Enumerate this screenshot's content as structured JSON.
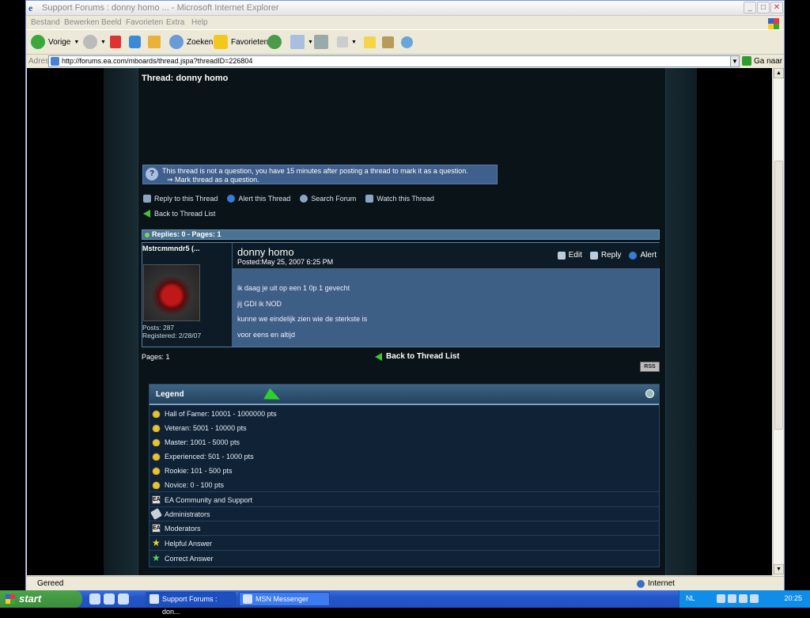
{
  "window": {
    "title": "Support Forums : donny homo ... - Microsoft Internet Explorer"
  },
  "menu": [
    "Bestand",
    "Bewerken",
    "Beeld",
    "Favorieten",
    "Extra",
    "Help"
  ],
  "toolbar": {
    "back": "Vorige",
    "search": "Zoeken",
    "favorites": "Favorieten"
  },
  "address": {
    "label": "Adres",
    "url": "http://forums.ea.com/mboards/thread.jspa?threadID=226804",
    "go": "Ga naar"
  },
  "page": {
    "thread_title": "Thread: donny homo",
    "info_line1": "This thread is not a question, you have 15 minutes after posting a thread to mark it as a question.",
    "info_line2": "Mark thread as a question.",
    "actions": {
      "reply": "Reply to this Thread",
      "alert": "Alert this Thread",
      "search": "Search Forum",
      "watch": "Watch this Thread"
    },
    "back_link": "Back to Thread List",
    "replies_bar": "Replies: 0 - Pages: 1",
    "post": {
      "author": "Mstrcmmndr5 (...",
      "posts": "Posts: 287",
      "registered": "Registered: 2/28/07",
      "title": "donny homo",
      "posted": "Posted:May 25, 2007 6:25 PM",
      "edit": "Edit",
      "reply": "Reply",
      "alert": "Alert",
      "lines": [
        "ik daag je uit op een 1 0p 1 gevecht",
        "jij GDI ik NOD",
        "kunne we eindelijk zien wie de sterkste is",
        "voor eens en altijd"
      ]
    },
    "pages": "Pages: 1",
    "back_link_bottom": "Back to Thread List",
    "rss": "RSS",
    "legend": {
      "title": "Legend",
      "items": [
        "Hall of Famer: 10001 - 1000000 pts",
        "Veteran: 5001 - 10000 pts",
        "Master: 1001 - 5000 pts",
        "Experienced: 501 - 1000 pts",
        "Rookie: 101 - 500 pts",
        "Novice: 0 - 100 pts",
        "EA Community and Support",
        "Administrators",
        "Moderators",
        "Helpful Answer",
        "Correct Answer"
      ]
    }
  },
  "status": {
    "text": "Gereed",
    "zone": "Internet"
  },
  "taskbar": {
    "start": "start",
    "tasks": [
      "Support Forums : don...",
      "MSN Messenger"
    ],
    "lang": "NL",
    "clock": "20:25"
  }
}
